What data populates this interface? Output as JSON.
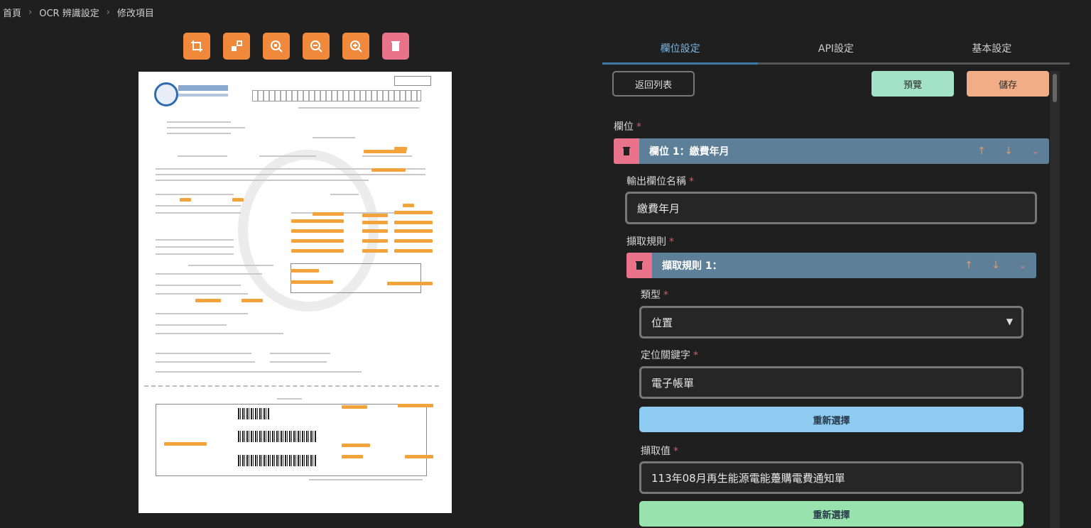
{
  "breadcrumb": {
    "home": "首頁",
    "ocr": "OCR 辨識設定",
    "edit": "修改項目"
  },
  "toolbar": {
    "crop_icon": "crop-icon",
    "fit_icon": "fit-icon",
    "zoom_fit_icon": "zoom-fit-icon",
    "zoom_out_icon": "zoom-out-icon",
    "zoom_in_icon": "zoom-in-icon",
    "delete_icon": "trash-icon"
  },
  "tabs": [
    "欄位設定",
    "API設定",
    "基本設定"
  ],
  "actions": {
    "back": "返回列表",
    "preview": "預覽",
    "save": "儲存"
  },
  "fields_label": "欄位",
  "field1": {
    "title": "欄位 1：繳費年月"
  },
  "output_name": {
    "label": "輸出欄位名稱",
    "value": "繳費年月"
  },
  "extract_rules_label": "擷取規則",
  "rule1": {
    "title": "擷取規則 1："
  },
  "type": {
    "label": "類型",
    "value": "位置"
  },
  "locate_keyword": {
    "label": "定位關鍵字",
    "value": "電子帳單"
  },
  "reselect1": "重新選擇",
  "extract_value": {
    "label": "擷取值",
    "value": "113年08月再生能源電能躉購電費通知單"
  },
  "reselect2": "重新選擇",
  "colors": {
    "accent": "#f0893c",
    "bar": "#5d7f97",
    "preview": "#a3e2c7",
    "save": "#f1ad86",
    "blue_btn": "#8ecbf0",
    "green_btn": "#98e3ad"
  }
}
